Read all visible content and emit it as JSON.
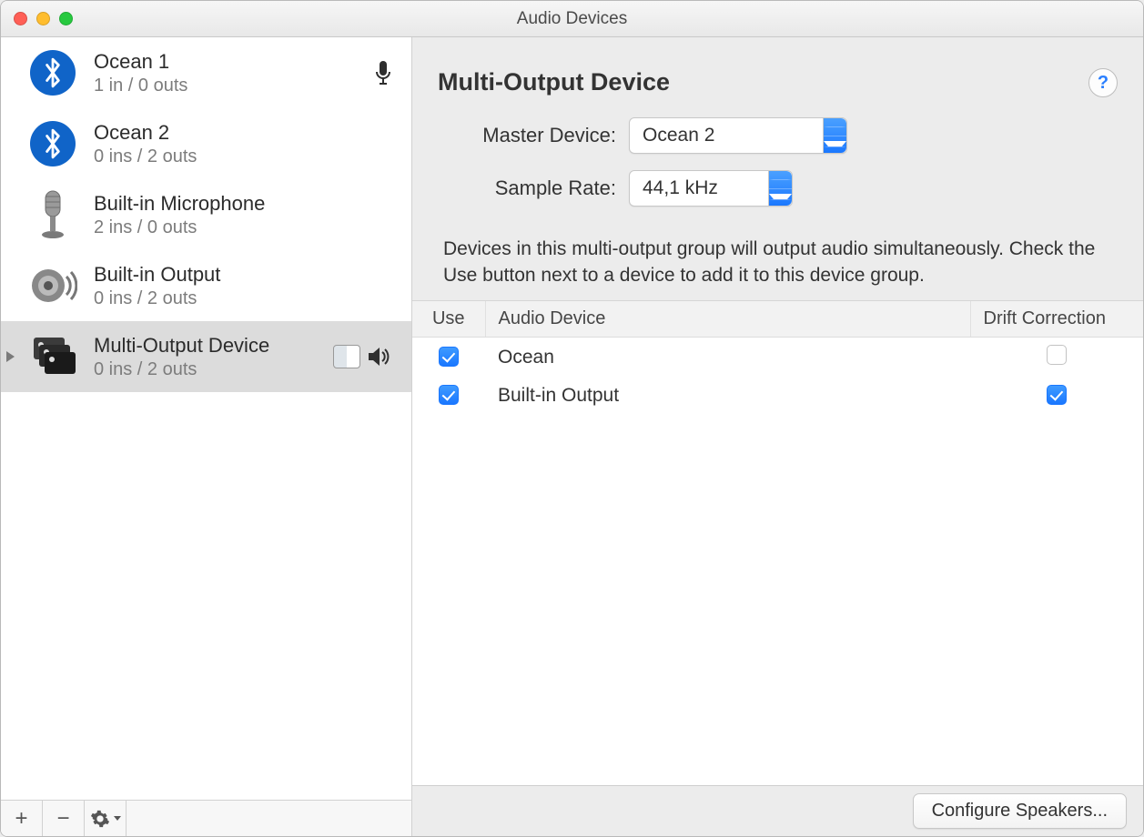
{
  "window": {
    "title": "Audio Devices"
  },
  "sidebar": {
    "items": [
      {
        "name": "Ocean 1",
        "sub": "1 in / 0 outs",
        "icon": "bluetooth",
        "default_input": true
      },
      {
        "name": "Ocean 2",
        "sub": "0 ins / 2 outs",
        "icon": "bluetooth"
      },
      {
        "name": "Built-in Microphone",
        "sub": "2 ins / 0 outs",
        "icon": "mic"
      },
      {
        "name": "Built-in Output",
        "sub": "0 ins / 2 outs",
        "icon": "speaker"
      },
      {
        "name": "Multi-Output Device",
        "sub": "0 ins / 2 outs",
        "icon": "multi",
        "selected": true,
        "system_output": true
      }
    ],
    "toolbar": {
      "add": "+",
      "remove": "−",
      "actions": "gear"
    }
  },
  "detail": {
    "title": "Multi-Output Device",
    "help": "?",
    "master_device": {
      "label": "Master Device:",
      "value": "Ocean 2"
    },
    "sample_rate": {
      "label": "Sample Rate:",
      "value": "44,1 kHz"
    },
    "description": "Devices in this multi-output group will output audio simultaneously. Check the Use button next to a device to add it to this device group.",
    "table": {
      "headers": {
        "use": "Use",
        "device": "Audio Device",
        "drift": "Drift Correction"
      },
      "rows": [
        {
          "use": true,
          "device": "Ocean",
          "drift": false
        },
        {
          "use": true,
          "device": "Built-in Output",
          "drift": true
        }
      ]
    },
    "footer": {
      "configure_speakers": "Configure Speakers..."
    }
  }
}
